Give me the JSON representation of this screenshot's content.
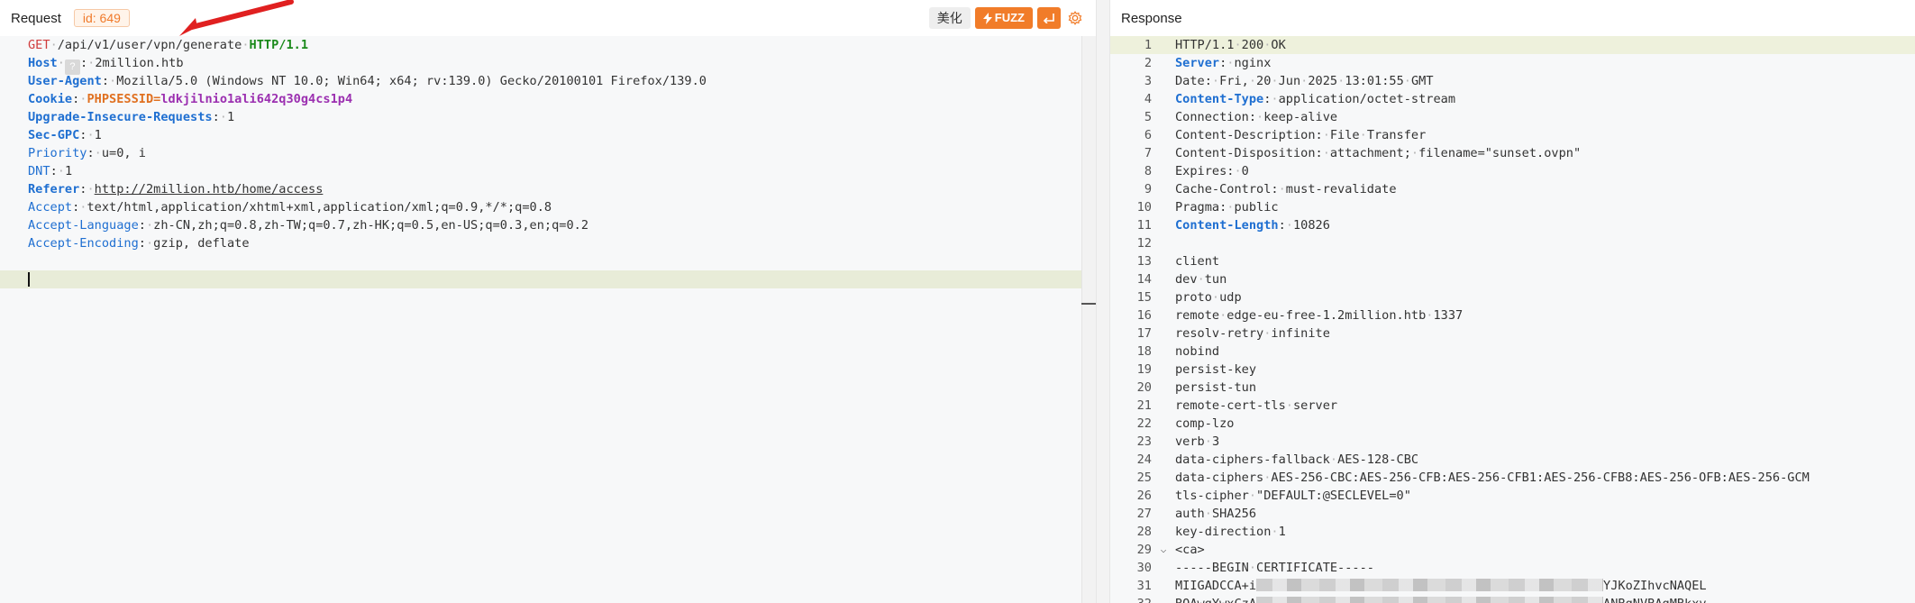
{
  "request": {
    "title": "Request",
    "id_badge": "id: 649",
    "beautify_label": "美化",
    "fuzz_label": "FUZZ",
    "host_hint": "?",
    "lines": {
      "l1": {
        "method": "GET",
        "path": "/api/v1/user/vpn/generate",
        "proto": "HTTP/1.1"
      },
      "l2": {
        "key": "Host",
        "value": "2million.htb"
      },
      "l3": {
        "key": "User-Agent",
        "value": "Mozilla/5.0 (Windows NT 10.0; Win64; x64; rv:139.0) Gecko/20100101 Firefox/139.0"
      },
      "l4": {
        "key": "Cookie",
        "ckey": "PHPSESSID",
        "cval": "ldkjilnio1ali642q30g4cs1p4"
      },
      "l5": {
        "key": "Upgrade-Insecure-Requests",
        "value": "1"
      },
      "l6": {
        "key": "Sec-GPC",
        "value": "1"
      },
      "l7": {
        "key": "Priority",
        "value": "u=0, i"
      },
      "l8": {
        "key": "DNT",
        "value": "1"
      },
      "l9": {
        "key": "Referer",
        "value": "http://2million.htb/home/access"
      },
      "l10": {
        "key": "Accept",
        "value": "text/html,application/xhtml+xml,application/xml;q=0.9,*/*;q=0.8"
      },
      "l11": {
        "key": "Accept-Language",
        "value": "zh-CN,zh;q=0.8,zh-TW;q=0.7,zh-HK;q=0.5,en-US;q=0.3,en;q=0.2"
      },
      "l12": {
        "key": "Accept-Encoding",
        "value": "gzip, deflate"
      }
    }
  },
  "response": {
    "title": "Response",
    "lines": [
      {
        "n": "1",
        "text": "HTTP/1.1 200 OK"
      },
      {
        "n": "2",
        "key": "Server",
        "value": "nginx",
        "bold": true
      },
      {
        "n": "3",
        "text": "Date: Fri, 20 Jun 2025 13:01:55 GMT"
      },
      {
        "n": "4",
        "key": "Content-Type",
        "value": "application/octet-stream",
        "bold": true
      },
      {
        "n": "5",
        "text": "Connection: keep-alive"
      },
      {
        "n": "6",
        "text": "Content-Description: File Transfer"
      },
      {
        "n": "7",
        "text": "Content-Disposition: attachment; filename=\"sunset.ovpn\""
      },
      {
        "n": "8",
        "text": "Expires: 0"
      },
      {
        "n": "9",
        "text": "Cache-Control: must-revalidate"
      },
      {
        "n": "10",
        "text": "Pragma: public"
      },
      {
        "n": "11",
        "key": "Content-Length",
        "value": "10826",
        "bold": true
      },
      {
        "n": "12",
        "text": ""
      },
      {
        "n": "13",
        "text": "client"
      },
      {
        "n": "14",
        "text": "dev tun"
      },
      {
        "n": "15",
        "text": "proto udp"
      },
      {
        "n": "16",
        "text": "remote edge-eu-free-1.2million.htb 1337"
      },
      {
        "n": "17",
        "text": "resolv-retry infinite"
      },
      {
        "n": "18",
        "text": "nobind"
      },
      {
        "n": "19",
        "text": "persist-key"
      },
      {
        "n": "20",
        "text": "persist-tun"
      },
      {
        "n": "21",
        "text": "remote-cert-tls server"
      },
      {
        "n": "22",
        "text": "comp-lzo"
      },
      {
        "n": "23",
        "text": "verb 3"
      },
      {
        "n": "24",
        "text": "data-ciphers-fallback AES-128-CBC"
      },
      {
        "n": "25",
        "text": "data-ciphers AES-256-CBC:AES-256-CFB:AES-256-CFB1:AES-256-CFB8:AES-256-OFB:AES-256-GCM"
      },
      {
        "n": "26",
        "text": "tls-cipher \"DEFAULT:@SECLEVEL=0\""
      },
      {
        "n": "27",
        "text": "auth SHA256"
      },
      {
        "n": "28",
        "text": "key-direction 1"
      },
      {
        "n": "29",
        "text": "<ca>",
        "fold": true
      },
      {
        "n": "30",
        "text": "-----BEGIN CERTIFICATE-----"
      },
      {
        "n": "31",
        "text": "MIIGADCCA+i",
        "redacted": true,
        "tail": "YJKoZIhvcNAQEL"
      },
      {
        "n": "32",
        "text": "BQAwgYwxCzA",
        "redacted": true,
        "tail": "ANBgNVBAgMBkxv"
      }
    ]
  },
  "colors": {
    "accent": "#f17c29",
    "header_key": "#1f6fd1",
    "method": "#d03c3c",
    "proto": "#1b8a1b",
    "cookie_key": "#e07020",
    "cookie_val": "#9b2fb0"
  },
  "icons": {
    "fuzz": "lightning-icon",
    "enter": "enter-icon",
    "settings": "gear-icon",
    "fold": "chevron-down-icon",
    "annotation": "red-arrow-icon"
  }
}
